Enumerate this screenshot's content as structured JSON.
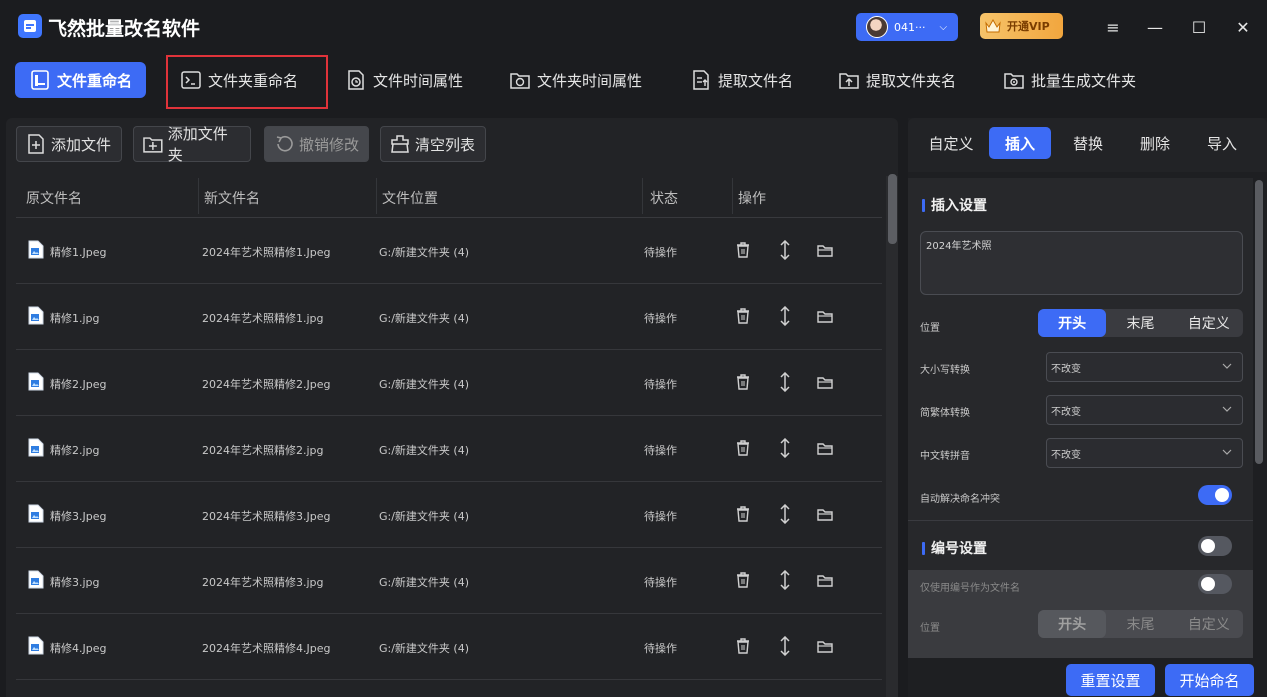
{
  "app": {
    "title": "飞然批量改名软件",
    "user_label": "041···",
    "vip_label": "开通VIP"
  },
  "tabs": [
    {
      "label": "文件重命名",
      "icon": "file-rename-icon"
    },
    {
      "label": "文件夹重命名",
      "icon": "terminal-folder-icon"
    },
    {
      "label": "文件时间属性",
      "icon": "file-clock-icon"
    },
    {
      "label": "文件夹时间属性",
      "icon": "folder-clock-icon"
    },
    {
      "label": "提取文件名",
      "icon": "extract-file-icon"
    },
    {
      "label": "提取文件夹名",
      "icon": "extract-folder-icon"
    },
    {
      "label": "批量生成文件夹",
      "icon": "generate-folder-icon"
    }
  ],
  "active_tab": "文件重命名",
  "toolbar": {
    "add_file": "添加文件",
    "add_folder": "添加文件夹",
    "undo": "撤销修改",
    "clear": "清空列表"
  },
  "table": {
    "columns": [
      "原文件名",
      "新文件名",
      "文件位置",
      "状态",
      "操作"
    ],
    "rows": [
      {
        "orig": "精修1.Jpeg",
        "new": "2024年艺术照精修1.Jpeg",
        "loc": "G:/新建文件夹 (4)",
        "status": "待操作"
      },
      {
        "orig": "精修1.jpg",
        "new": "2024年艺术照精修1.jpg",
        "loc": "G:/新建文件夹 (4)",
        "status": "待操作"
      },
      {
        "orig": "精修2.Jpeg",
        "new": "2024年艺术照精修2.Jpeg",
        "loc": "G:/新建文件夹 (4)",
        "status": "待操作"
      },
      {
        "orig": "精修2.jpg",
        "new": "2024年艺术照精修2.jpg",
        "loc": "G:/新建文件夹 (4)",
        "status": "待操作"
      },
      {
        "orig": "精修3.Jpeg",
        "new": "2024年艺术照精修3.Jpeg",
        "loc": "G:/新建文件夹 (4)",
        "status": "待操作"
      },
      {
        "orig": "精修3.jpg",
        "new": "2024年艺术照精修3.jpg",
        "loc": "G:/新建文件夹 (4)",
        "status": "待操作"
      },
      {
        "orig": "精修4.Jpeg",
        "new": "2024年艺术照精修4.Jpeg",
        "loc": "G:/新建文件夹 (4)",
        "status": "待操作"
      }
    ]
  },
  "right": {
    "tabs": [
      "自定义",
      "插入",
      "替换",
      "删除",
      "导入"
    ],
    "active_tab": "插入",
    "insert": {
      "title": "插入设置",
      "text_value": "2024年艺术照",
      "position_label": "位置",
      "position_options": [
        "开头",
        "末尾",
        "自定义"
      ],
      "position_selected": "开头",
      "case_label": "大小写转换",
      "case_value": "不改变",
      "trad_label": "简繁体转换",
      "trad_value": "不改变",
      "pinyin_label": "中文转拼音",
      "pinyin_value": "不改变",
      "conflict_label": "自动解决命名冲突",
      "conflict_on": true
    },
    "numbering": {
      "title": "编号设置",
      "enabled": false,
      "only_number_label": "仅使用编号作为文件名",
      "only_number_on": false,
      "position_label": "位置",
      "position_options": [
        "开头",
        "末尾",
        "自定义"
      ],
      "position_selected": "开头"
    },
    "reset_label": "重置设置",
    "start_label": "开始命名"
  },
  "colors": {
    "accent": "#3d6bf5",
    "highlight_border": "#e0333a",
    "vip": "#f2a63e"
  }
}
